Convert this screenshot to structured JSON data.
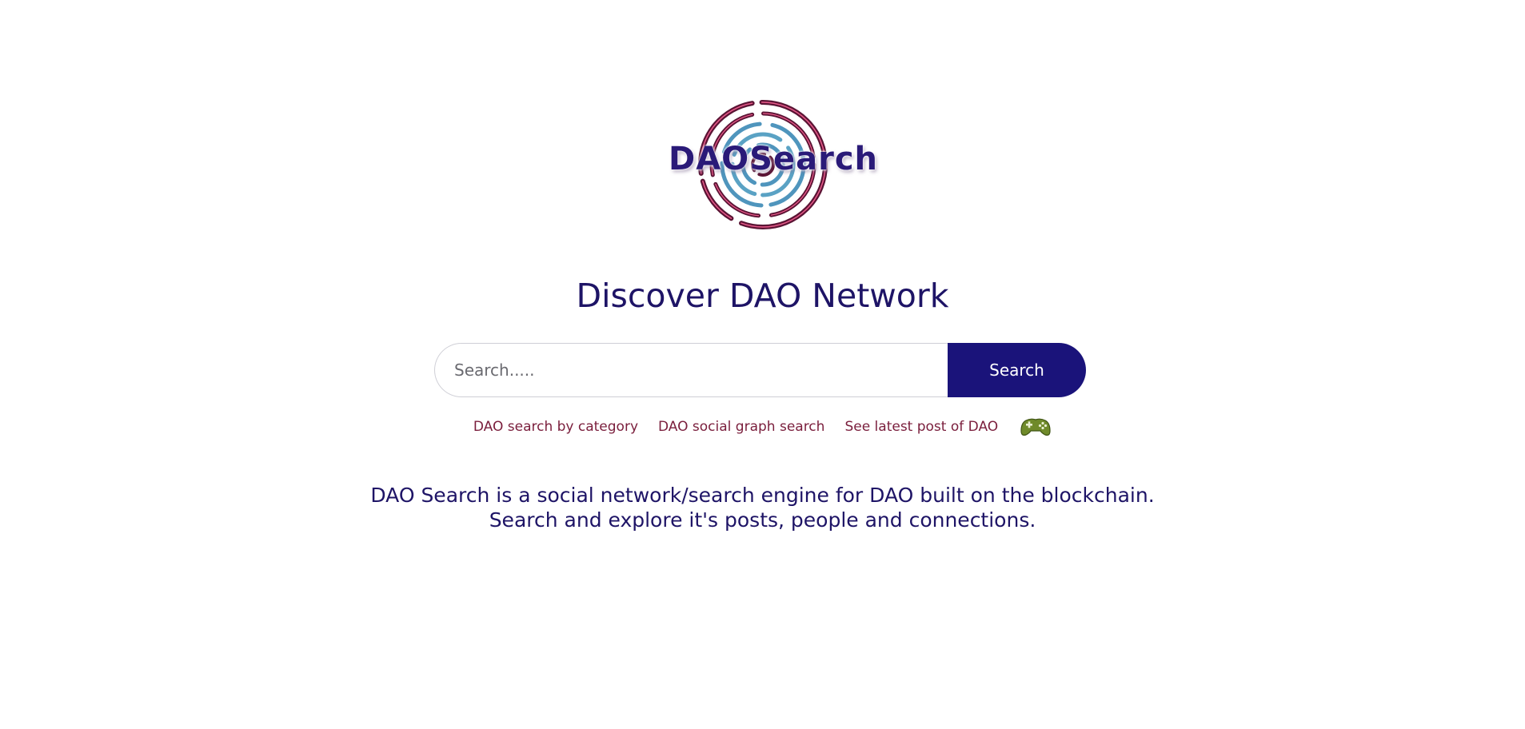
{
  "brand": {
    "logo_text": "DAOSearch",
    "primary_color": "#1a137a",
    "ring_colors": [
      "#6b1a3a",
      "#e04a7a",
      "#5aa2c4"
    ]
  },
  "headline": "Discover DAO Network",
  "search": {
    "placeholder": "Search.....",
    "value": "",
    "button_label": "Search"
  },
  "links": [
    {
      "label": "DAO search by category"
    },
    {
      "label": "DAO social graph search"
    },
    {
      "label": "See latest post of DAO"
    }
  ],
  "game_link_icon": "gamepad-icon",
  "description": {
    "line1": "DAO Search is a social network/search engine for DAO built on the blockchain.",
    "line2": "Search and explore it's posts, people and connections."
  }
}
